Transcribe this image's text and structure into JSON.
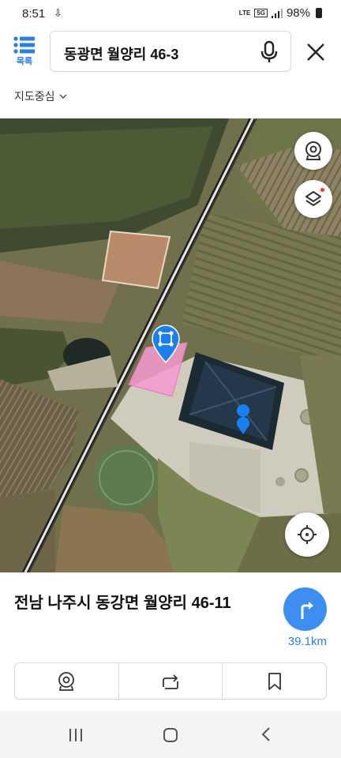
{
  "status_bar": {
    "time": "8:51",
    "notification_icon": "download-icon",
    "network_label": "5G",
    "lte_label": "LTE",
    "battery": "98%"
  },
  "header": {
    "list_label": "목록",
    "search_value": "동광면 월양리 46-3",
    "mic_icon": "mic-icon",
    "close_icon": "close-icon"
  },
  "map_center": {
    "label": "지도중심"
  },
  "map": {
    "highlight_color": "#f79ad0",
    "marker_color": "#1a7ff0",
    "buttons": [
      "roadview-icon",
      "layers-icon",
      "locate-icon"
    ]
  },
  "info": {
    "address": "전남 나주시 동강면 월양리 46-11",
    "distance": "39.1km",
    "actions": [
      "roadview-icon",
      "share-icon",
      "bookmark-icon"
    ]
  },
  "nav": [
    "recent-apps-icon",
    "home-icon",
    "back-icon"
  ],
  "colors": {
    "accent": "#2e7ee0",
    "route_button": "#3d8ef0"
  }
}
